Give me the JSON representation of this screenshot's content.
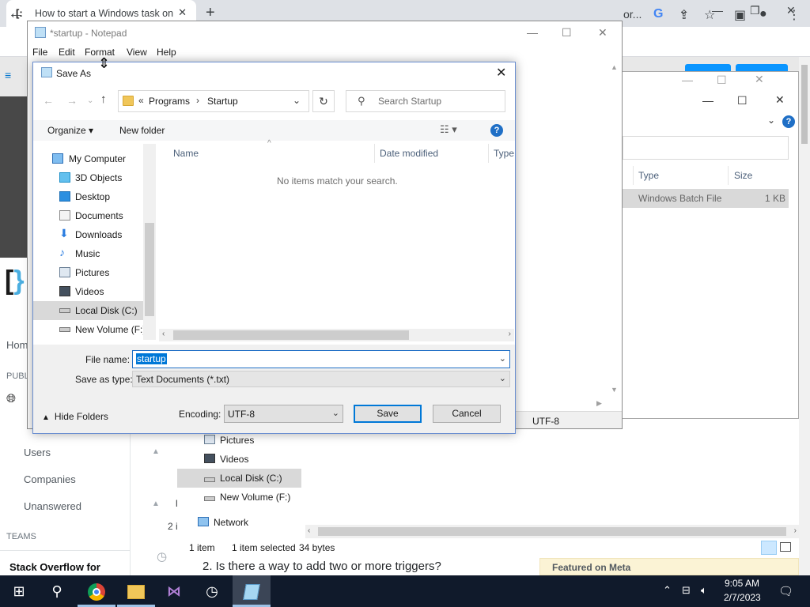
{
  "chrome": {
    "tab_title": "How to start a Windows task on",
    "tab_favicon": "[:",
    "new_tab_glyph": "+",
    "address_fragment": "or..."
  },
  "so": {
    "logo": "[",
    "logo_accent": "}",
    "nav": {
      "home": "Hom",
      "public": "PUBL",
      "users": "Users",
      "companies": "Companies",
      "unanswered": "Unanswered",
      "teams": "TEAMS",
      "teams_promo": "Stack Overflow for"
    },
    "frag_2": "2 i",
    "frag_l": "l",
    "question_2": "2. Is there a way to add two or more triggers?",
    "featured_meta": "Featured on Meta"
  },
  "explorer": {
    "columns": {
      "type": "Type",
      "size": "Size"
    },
    "row": {
      "type": "Windows Batch File",
      "size": "1 KB"
    },
    "nav": [
      {
        "label": "Pictures"
      },
      {
        "label": "Videos"
      },
      {
        "label": "Local Disk (C:)"
      },
      {
        "label": "New Volume (F:)"
      },
      {
        "label": "Network"
      }
    ],
    "status": {
      "items": "1 item",
      "selected": "1 item selected",
      "size": "34 bytes"
    }
  },
  "notepad": {
    "title": "*startup - Notepad",
    "menu": [
      "File",
      "Edit",
      "Format",
      "View",
      "Help"
    ],
    "encoding": "UTF-8"
  },
  "saveas": {
    "title": "Save As",
    "breadcrumb": {
      "prefix": "«",
      "folder1": "Programs",
      "separator": "›",
      "folder2": "Startup"
    },
    "search_placeholder": "Search Startup",
    "organize": "Organize ▾",
    "new_folder": "New folder",
    "help": "?",
    "tree": [
      {
        "label": "My Computer",
        "icon": "computer-icon"
      },
      {
        "label": "3D Objects",
        "icon": "3d-objects-icon"
      },
      {
        "label": "Desktop",
        "icon": "desktop-icon"
      },
      {
        "label": "Documents",
        "icon": "documents-icon"
      },
      {
        "label": "Downloads",
        "icon": "downloads-icon"
      },
      {
        "label": "Music",
        "icon": "music-icon"
      },
      {
        "label": "Pictures",
        "icon": "pictures-icon"
      },
      {
        "label": "Videos",
        "icon": "videos-icon"
      },
      {
        "label": "Local Disk (C:)",
        "icon": "drive-icon",
        "selected": true
      },
      {
        "label": "New Volume (F:)",
        "icon": "drive-icon"
      }
    ],
    "columns": {
      "name": "Name",
      "date": "Date modified",
      "type": "Type"
    },
    "empty_message": "No items match your search.",
    "file_name_label": "File name:",
    "file_name_value": "startup",
    "save_type_label": "Save as type:",
    "save_type_value": "Text Documents (*.txt)",
    "hide_folders": "Hide Folders",
    "encoding_label": "Encoding:",
    "encoding_value": "UTF-8",
    "save_label": "Save",
    "cancel_label": "Cancel"
  },
  "taskbar": {
    "time": "9:05 AM",
    "date": "2/7/2023"
  },
  "colors": {
    "taskbar": "#101a2b",
    "accent": "#0078d7",
    "so_blue": "#0a95ff"
  }
}
